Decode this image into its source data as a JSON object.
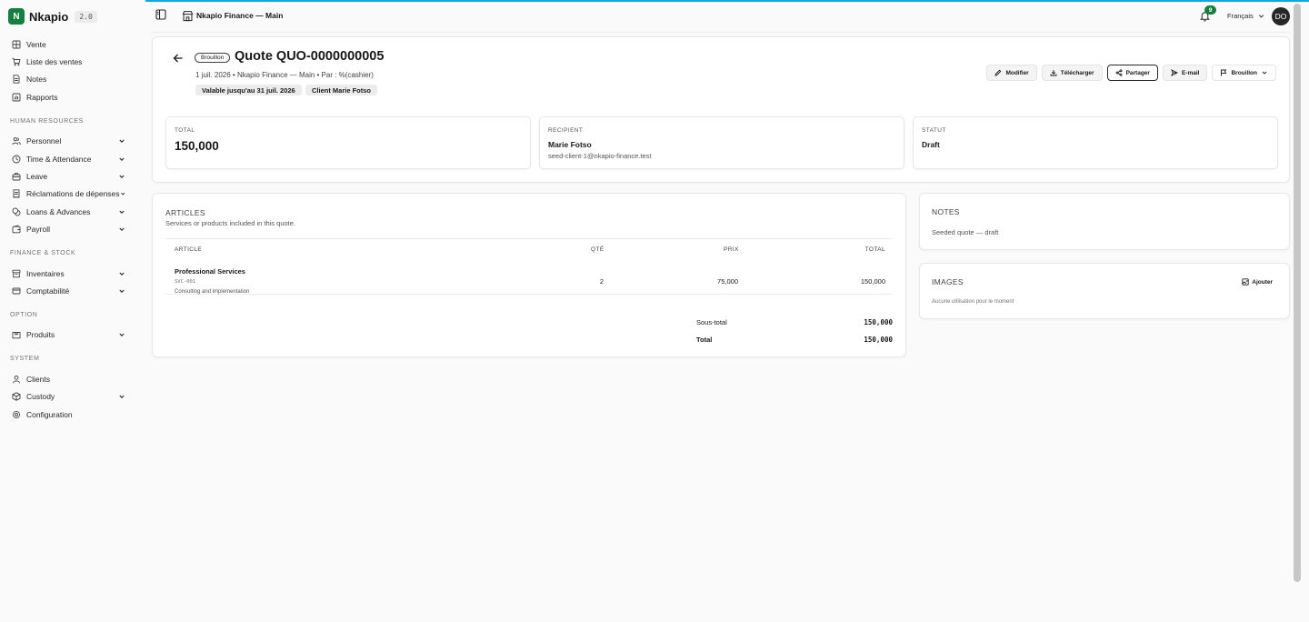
{
  "app": {
    "name": "Nkapio",
    "version": "2.0",
    "logo_letter": "N",
    "accent": "#15803d"
  },
  "header": {
    "store": "Nkapio Finance — Main",
    "notifications": "9",
    "language": "Français",
    "user_initials": "DO"
  },
  "sidebar": {
    "top": [
      {
        "label": "Vente",
        "icon": "grid-icon"
      },
      {
        "label": "Liste des ventes",
        "icon": "cart-icon"
      },
      {
        "label": "Notes",
        "icon": "document-icon"
      },
      {
        "label": "Rapports",
        "icon": "chart-icon"
      }
    ],
    "sections": [
      {
        "title": "HUMAN RESOURCES",
        "items": [
          {
            "label": "Personnel",
            "icon": "users-icon",
            "expandable": true
          },
          {
            "label": "Time & Attendance",
            "icon": "clock-icon",
            "expandable": true
          },
          {
            "label": "Leave",
            "icon": "suitcase-icon",
            "expandable": true
          },
          {
            "label": "Réclamations de dépenses",
            "icon": "receipt-icon",
            "expandable": true
          },
          {
            "label": "Loans & Advances",
            "icon": "coins-icon",
            "expandable": true
          },
          {
            "label": "Payroll",
            "icon": "wallet-icon",
            "expandable": true
          }
        ]
      },
      {
        "title": "FINANCE & STOCK",
        "items": [
          {
            "label": "Inventaires",
            "icon": "archive-icon",
            "expandable": true
          },
          {
            "label": "Comptabilité",
            "icon": "card-icon",
            "expandable": true
          }
        ]
      },
      {
        "title": "OPTION",
        "items": [
          {
            "label": "Produits",
            "icon": "box-icon",
            "expandable": true
          }
        ]
      },
      {
        "title": "SYSTEM",
        "items": [
          {
            "label": "Clients",
            "icon": "user-icon",
            "expandable": false
          },
          {
            "label": "Custody",
            "icon": "cube-icon",
            "expandable": true
          },
          {
            "label": "Configuration",
            "icon": "gear-icon",
            "expandable": false
          }
        ]
      }
    ]
  },
  "quote": {
    "status": "Brouillon",
    "title": "Quote QUO-0000000005",
    "meta": "1 juil. 2026 • Nkapio Finance — Main • Par : %(cashier)",
    "valid_until": "Valable jusqu'au 31 juil. 2026",
    "client_chip": "Client Marie Fotso"
  },
  "actions": {
    "edit": "Modifier",
    "download": "Télécharger",
    "share": "Partager",
    "email": "E-mail",
    "status_menu": "Brouillon"
  },
  "stats": {
    "total_label": "TOTAL",
    "total_value": "150,000",
    "recipient_label": "RECIPIENT",
    "recipient_name": "Marie Fotso",
    "recipient_email": "seed-client-1@nkapio-finance.test",
    "status_label": "STATUT",
    "status_value": "Draft"
  },
  "articles": {
    "title": "ARTICLES",
    "subtitle": "Services or products included in this quote.",
    "columns": {
      "article": "ARTICLE",
      "qty": "QTÉ",
      "price": "PRIX",
      "total": "TOTAL"
    },
    "rows": [
      {
        "name": "Professional Services",
        "sku": "SVC-001",
        "description": "Consulting and implementation",
        "qty": "2",
        "price": "75,000",
        "total": "150,000"
      }
    ],
    "subtotal_label": "Sous-total",
    "subtotal": "150,000",
    "total_label": "Total",
    "total": "150,000"
  },
  "notes": {
    "title": "NOTES",
    "body": "Seeded quote — draft"
  },
  "images": {
    "title": "IMAGES",
    "add": "Ajouter",
    "empty": "Aucune utilisation pour le moment"
  }
}
